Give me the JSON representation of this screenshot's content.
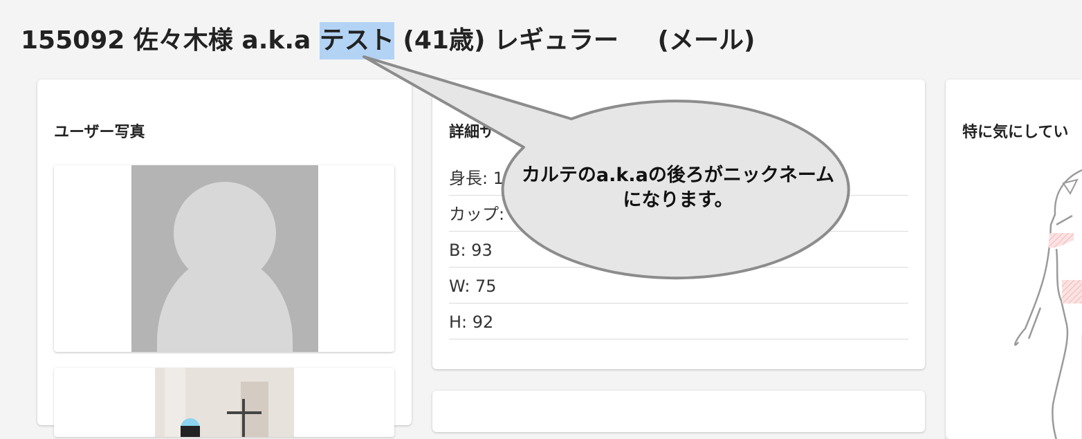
{
  "header": {
    "id": "155092",
    "name": "佐々木様",
    "aka_label": "a.k.a",
    "nickname": "テスト",
    "age": "(41歳)",
    "member_type": "レギュラー",
    "contact": "(メール)"
  },
  "photo_card": {
    "title": "ユーザー写真"
  },
  "detail_card": {
    "title": "詳細サ",
    "items": [
      {
        "text": "身長: 1"
      },
      {
        "text": "カップ: "
      },
      {
        "text": "B: 93"
      },
      {
        "text": "W: 75"
      },
      {
        "text": "H: 92"
      }
    ]
  },
  "concern_card": {
    "title": "特に気にしてい"
  },
  "callout": {
    "line1": "カルテのa.k.aの後ろがニックネーム",
    "line2": "になります。"
  },
  "colors": {
    "background": "#f4f4f4",
    "highlight": "#b3d3f5",
    "callout_fill": "#e6e6e6",
    "callout_border": "#8c8c8c"
  },
  "icons": [
    "avatar-placeholder-icon",
    "body-diagram-icon"
  ]
}
